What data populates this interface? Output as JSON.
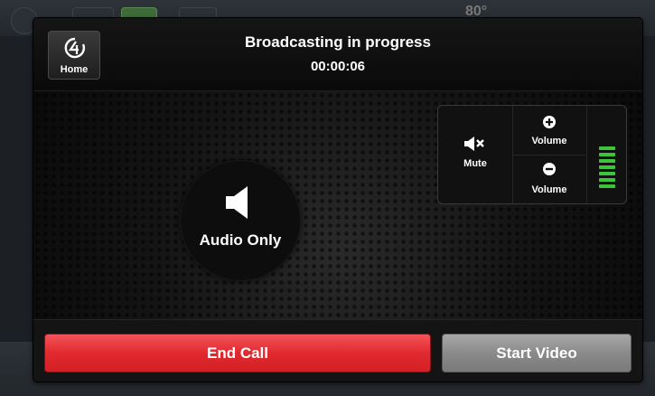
{
  "header": {
    "home_label": "Home",
    "title": "Broadcasting in progress",
    "timer": "00:00:06"
  },
  "stage": {
    "mode_label": "Audio Only",
    "mode_icon": "speaker-icon"
  },
  "volume_panel": {
    "mute_label": "Mute",
    "volume_up_label": "Volume",
    "volume_down_label": "Volume",
    "meter_level": 1.0,
    "meter_color": "#3ec43a"
  },
  "footer": {
    "end_call_label": "End Call",
    "start_video_label": "Start Video",
    "end_call_color": "#e02a30",
    "start_video_color": "#8a8a8a"
  },
  "background": {
    "partial_text": "80°"
  }
}
